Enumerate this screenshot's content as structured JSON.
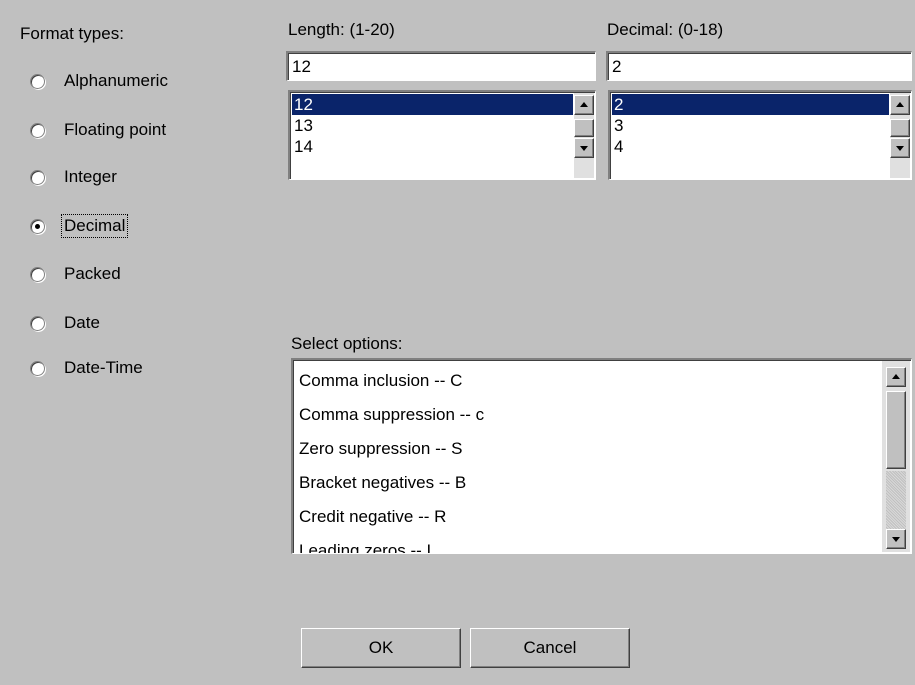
{
  "format": {
    "label": "Format types:",
    "options": [
      {
        "label": "Alphanumeric",
        "checked": false
      },
      {
        "label": "Floating point",
        "checked": false
      },
      {
        "label": "Integer",
        "checked": false
      },
      {
        "label": "Decimal",
        "checked": true
      },
      {
        "label": "Packed",
        "checked": false
      },
      {
        "label": "Date",
        "checked": false
      },
      {
        "label": "Date-Time",
        "checked": false
      }
    ]
  },
  "length": {
    "label": "Length: (1-20)",
    "value": "12",
    "list": [
      "12",
      "13",
      "14"
    ],
    "selected": "12"
  },
  "decimal": {
    "label": "Decimal: (0-18)",
    "value": "2",
    "list": [
      "2",
      "3",
      "4"
    ],
    "selected": "2"
  },
  "select_options": {
    "label": "Select options:",
    "items": [
      "Comma inclusion -- C",
      "Comma suppression -- c",
      "Zero suppression -- S",
      "Bracket negatives -- B",
      "Credit negative -- R",
      "Leading zeros -- L"
    ]
  },
  "buttons": {
    "ok": "OK",
    "cancel": "Cancel"
  },
  "colors": {
    "background": "#c0c0c0",
    "selection": "#0a246a"
  }
}
